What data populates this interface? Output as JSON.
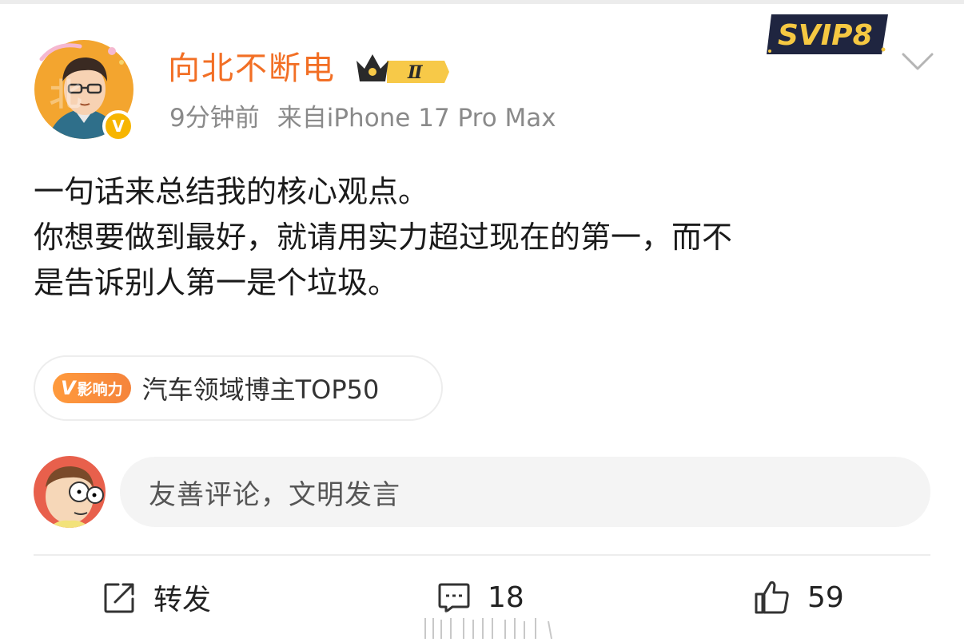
{
  "post": {
    "username": "向北不断电",
    "rank_badge": "Ⅱ",
    "time": "9分钟前",
    "source": "来自iPhone 17 Pro Max",
    "vip_label": "SVIP8",
    "verified_mark": "V",
    "content_lines": [
      "一句话来总结我的核心观点。",
      "你想要做到最好，就请用实力超过现在的第一，而不",
      "是告诉别人第一是个垃圾。"
    ],
    "influence_badge": {
      "v": "V",
      "text": "影响力"
    },
    "influence_tag": "汽车领域博主TOP50"
  },
  "comment_box": {
    "placeholder": "友善评论，文明发言"
  },
  "actions": {
    "share_label": "转发",
    "comment_count": "18",
    "like_count": "59"
  },
  "icons": [
    "chevron-down-icon",
    "share-icon",
    "comment-icon",
    "like-icon",
    "crown-icon"
  ],
  "colors": {
    "username": "#f26f25",
    "accent": "#f7b500",
    "muted": "#8a8a8a",
    "tag": "#f5843c"
  }
}
